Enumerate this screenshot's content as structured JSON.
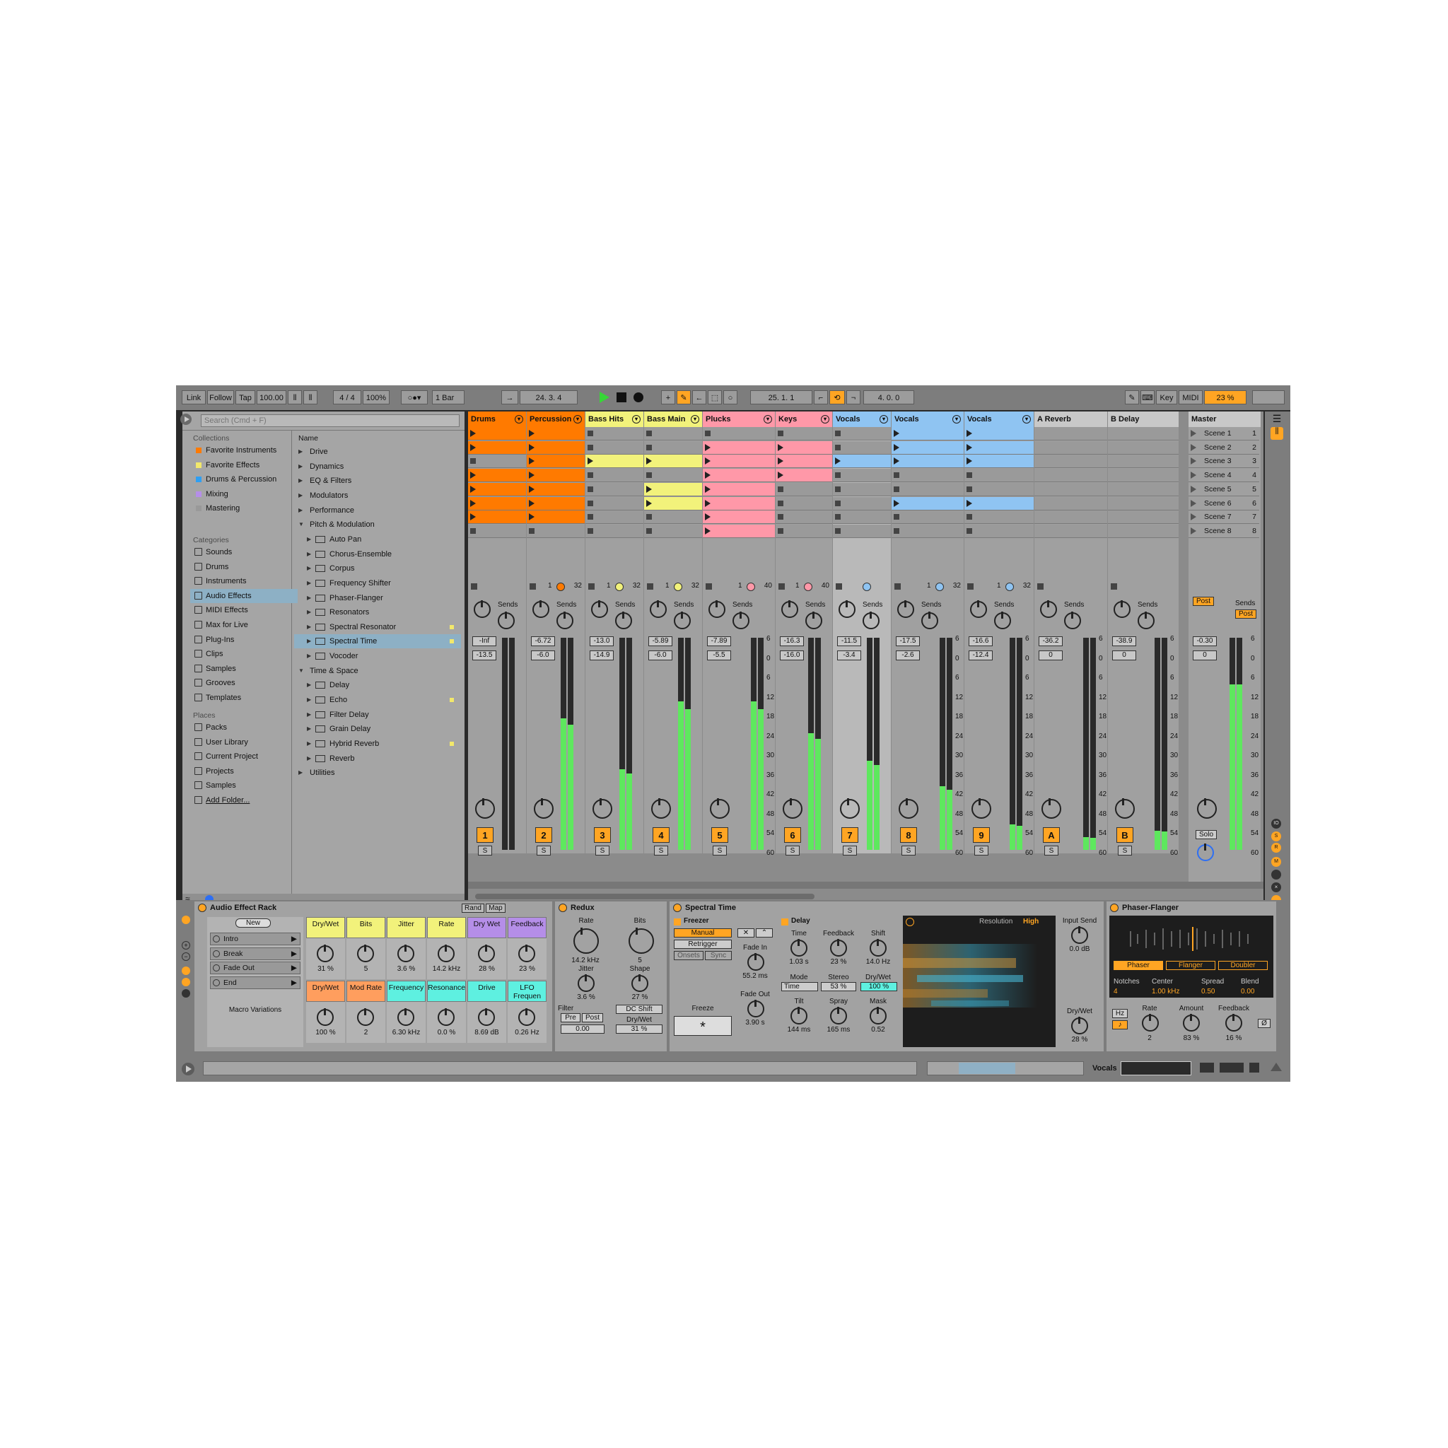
{
  "control_bar": {
    "link": "Link",
    "follow": "Follow",
    "tap": "Tap",
    "tempo": "100.00",
    "signature": "4 / 4",
    "zoom": "100%",
    "quantize": "1 Bar",
    "position": "24.  3.  4",
    "loop_start": "25.  1.  1",
    "loop_length": "4.  0.  0",
    "key": "Key",
    "midi": "MIDI",
    "cpu": "23 %"
  },
  "browser": {
    "search_placeholder": "Search (Cmd + F)",
    "collections_header": "Collections",
    "collections": [
      {
        "label": "Favorite Instruments",
        "color": "#ff7a00"
      },
      {
        "label": "Favorite Effects",
        "color": "#f2e86b"
      },
      {
        "label": "Drums & Percussion",
        "color": "#2e9ff3"
      },
      {
        "label": "Mixing",
        "color": "#b58ee8"
      },
      {
        "label": "Mastering",
        "color": "#999999"
      }
    ],
    "categories_header": "Categories",
    "categories": [
      "Sounds",
      "Drums",
      "Instruments",
      "Audio Effects",
      "MIDI Effects",
      "Max for Live",
      "Plug-Ins",
      "Clips",
      "Samples",
      "Grooves",
      "Templates"
    ],
    "places_header": "Places",
    "places": [
      "Packs",
      "User Library",
      "Current Project",
      "Projects",
      "Samples",
      "Add Folder..."
    ],
    "name_header": "Name",
    "files": [
      {
        "label": "Drive",
        "level": 0
      },
      {
        "label": "Dynamics",
        "level": 0
      },
      {
        "label": "EQ & Filters",
        "level": 0
      },
      {
        "label": "Modulators",
        "level": 0
      },
      {
        "label": "Performance",
        "level": 0
      },
      {
        "label": "Pitch & Modulation",
        "level": 0,
        "open": true
      },
      {
        "label": "Auto Pan",
        "level": 1
      },
      {
        "label": "Chorus-Ensemble",
        "level": 1
      },
      {
        "label": "Corpus",
        "level": 1
      },
      {
        "label": "Frequency Shifter",
        "level": 1
      },
      {
        "label": "Phaser-Flanger",
        "level": 1
      },
      {
        "label": "Resonators",
        "level": 1
      },
      {
        "label": "Spectral Resonator",
        "level": 1,
        "dot": true
      },
      {
        "label": "Spectral Time",
        "level": 1,
        "dot": true,
        "selected": true
      },
      {
        "label": "Vocoder",
        "level": 1
      },
      {
        "label": "Time & Space",
        "level": 0,
        "open": true
      },
      {
        "label": "Delay",
        "level": 1
      },
      {
        "label": "Echo",
        "level": 1,
        "dot": true
      },
      {
        "label": "Filter Delay",
        "level": 1
      },
      {
        "label": "Grain Delay",
        "level": 1
      },
      {
        "label": "Hybrid Reverb",
        "level": 1,
        "dot": true
      },
      {
        "label": "Reverb",
        "level": 1
      },
      {
        "label": "Utilities",
        "level": 0
      }
    ]
  },
  "tracks": [
    {
      "name": "Drums",
      "num": "1",
      "color": "#ff7a00",
      "clips": [
        1,
        1,
        0,
        1,
        1,
        1,
        1,
        0
      ],
      "vol": "-Inf",
      "pan": "-13.5",
      "level": 0.0,
      "clip_count": "",
      "dev": "",
      "sel": false
    },
    {
      "name": "Percussion",
      "num": "2",
      "color": "#ff7a00",
      "clips": [
        1,
        1,
        1,
        1,
        1,
        1,
        1,
        0
      ],
      "vol": "-6.72",
      "pan": "-6.0",
      "level": 0.62,
      "clip_count": "1",
      "dev": "32",
      "sel": false
    },
    {
      "name": "Bass Hits",
      "num": "3",
      "color": "#f2f27b",
      "clips": [
        0,
        0,
        1,
        0,
        0,
        0,
        0,
        0
      ],
      "vol": "-13.0",
      "pan": "-14.9",
      "level": 0.38,
      "clip_count": "1",
      "dev": "32",
      "sel": false
    },
    {
      "name": "Bass Main",
      "num": "4",
      "color": "#f2f27b",
      "clips": [
        0,
        0,
        1,
        0,
        1,
        1,
        0,
        0
      ],
      "vol": "-5.89",
      "pan": "-6.0",
      "level": 0.7,
      "clip_count": "1",
      "dev": "32",
      "sel": false
    },
    {
      "name": "Plucks",
      "num": "5",
      "color": "#ff98a8",
      "clips": [
        0,
        1,
        1,
        1,
        1,
        1,
        1,
        1
      ],
      "vol": "-7.89",
      "pan": "-5.5",
      "level": 0.7,
      "clip_count": "1",
      "dev": "40",
      "sel": false
    },
    {
      "name": "Keys",
      "num": "6",
      "color": "#ff98a8",
      "clips": [
        0,
        1,
        1,
        1,
        0,
        0,
        0,
        0
      ],
      "vol": "-16.3",
      "pan": "-16.0",
      "level": 0.55,
      "clip_count": "1",
      "dev": "40",
      "sel": false
    },
    {
      "name": "Vocals",
      "num": "7",
      "color": "#8fc4f2",
      "clips": [
        0,
        0,
        1,
        0,
        0,
        0,
        0,
        0
      ],
      "vol": "-11.5",
      "pan": "-3.4",
      "level": 0.42,
      "clip_count": "",
      "dev": "",
      "sel": true
    },
    {
      "name": "Vocals",
      "num": "8",
      "color": "#8fc4f2",
      "clips": [
        1,
        1,
        1,
        0,
        0,
        1,
        0,
        0
      ],
      "vol": "-17.5",
      "pan": "-2.6",
      "level": 0.3,
      "clip_count": "1",
      "dev": "32",
      "sel": false
    },
    {
      "name": "Vocals",
      "num": "9",
      "color": "#8fc4f2",
      "clips": [
        1,
        1,
        1,
        0,
        0,
        1,
        0,
        0
      ],
      "vol": "-16.6",
      "pan": "-12.4",
      "level": 0.12,
      "clip_count": "1",
      "dev": "32",
      "sel": false
    },
    {
      "name": "A Reverb",
      "num": "A",
      "color": "#c8c8c8",
      "clips": [
        0,
        0,
        0,
        0,
        0,
        0,
        0,
        0
      ],
      "vol": "-36.2",
      "pan": "0",
      "level": 0.06,
      "clip_count": "",
      "dev": "",
      "sel": false
    },
    {
      "name": "B Delay",
      "num": "B",
      "color": "#c8c8c8",
      "clips": [
        0,
        0,
        0,
        0,
        0,
        0,
        0,
        0
      ],
      "vol": "-38.9",
      "pan": "0",
      "level": 0.09,
      "clip_count": "",
      "dev": "",
      "sel": false
    }
  ],
  "master": {
    "name": "Master",
    "vol": "-0.30",
    "pan": "0",
    "level": 0.78,
    "solo": "Solo",
    "post": "Post"
  },
  "scenes": [
    "Scene 1",
    "Scene 2",
    "Scene 3",
    "Scene 4",
    "Scene 5",
    "Scene 6",
    "Scene 7",
    "Scene 8"
  ],
  "scene_nums": [
    "1",
    "2",
    "3",
    "4",
    "5",
    "6",
    "7",
    "8"
  ],
  "sends_label": "Sends",
  "db_scale": [
    "6",
    "0",
    "6",
    "12",
    "18",
    "24",
    "30",
    "36",
    "42",
    "48",
    "54",
    "60"
  ],
  "rack": {
    "title": "Audio Effect Rack",
    "rand": "Rand",
    "map": "Map",
    "new": "New",
    "variations": [
      "Intro",
      "Break",
      "Fade Out",
      "End"
    ],
    "variations_label": "Macro Variations",
    "macros": [
      {
        "name": "Dry/Wet",
        "value": "31 %",
        "color": "#f2f27b"
      },
      {
        "name": "Bits",
        "value": "5",
        "color": "#f2f27b"
      },
      {
        "name": "Jitter",
        "value": "3.6 %",
        "color": "#f2f27b"
      },
      {
        "name": "Rate",
        "value": "14.2 kHz",
        "color": "#f2f27b"
      },
      {
        "name": "Dry Wet",
        "value": "28 %",
        "color": "#b58ee8"
      },
      {
        "name": "Feedback",
        "value": "23 %",
        "color": "#b58ee8"
      },
      {
        "name": "Dry/Wet",
        "value": "100 %",
        "color": "#ff9e5e"
      },
      {
        "name": "Mod Rate",
        "value": "2",
        "color": "#ff9e5e"
      },
      {
        "name": "Frequency",
        "value": "6.30 kHz",
        "color": "#5ef0e0"
      },
      {
        "name": "Resonance",
        "value": "0.0 %",
        "color": "#5ef0e0"
      },
      {
        "name": "Drive",
        "value": "8.69 dB",
        "color": "#5ef0e0"
      },
      {
        "name": "LFO Frequen",
        "value": "0.26 Hz",
        "color": "#5ef0e0"
      }
    ]
  },
  "redux": {
    "title": "Redux",
    "rate": "Rate",
    "rate_value": "14.2 kHz",
    "jitter": "Jitter",
    "jitter_value": "3.6 %",
    "bits": "Bits",
    "bits_value": "5",
    "shape": "Shape",
    "shape_value": "27 %",
    "filter": "Filter",
    "pre": "Pre",
    "post": "Post",
    "filter_value": "0.00",
    "dc_shift": "DC Shift",
    "dry_wet": "Dry/Wet",
    "dry_wet_value": "31 %"
  },
  "spectral_time": {
    "title": "Spectral Time",
    "freezer": "Freezer",
    "manual": "Manual",
    "retrigger": "Retrigger",
    "onsets": "Onsets",
    "sync": "Sync",
    "fade_in": "Fade In",
    "fade_in_value": "55.2 ms",
    "fade_out": "Fade Out",
    "fade_out_value": "3.90 s",
    "freeze": "Freeze",
    "freeze_symbol": "*",
    "delay": "Delay",
    "time": "Time",
    "time_value": "1.03 s",
    "feedback": "Feedback",
    "feedback_value": "23 %",
    "shift": "Shift",
    "shift_value": "14.0 Hz",
    "mode": "Mode",
    "mode_value": "Time",
    "stereo": "Stereo",
    "stereo_value": "53 %",
    "dry_wet": "Dry/Wet",
    "dry_wet_value": "100 %",
    "tilt": "Tilt",
    "tilt_value": "144 ms",
    "spray": "Spray",
    "spray_value": "165 ms",
    "mask": "Mask",
    "mask_value": "0.52",
    "resolution": "Resolution",
    "resolution_value": "High",
    "input_send": "Input Send",
    "input_send_value": "0.0 dB",
    "dw2": "Dry/Wet",
    "dw2_value": "28 %"
  },
  "phaser": {
    "title": "Phaser-Flanger",
    "modes": [
      "Phaser",
      "Flanger",
      "Doubler"
    ],
    "notches": "Notches",
    "notches_value": "4",
    "center": "Center",
    "center_value": "1.00 kHz",
    "spread": "Spread",
    "spread_value": "0.50",
    "blend": "Blend",
    "blend_value": "0.00",
    "hz": "Hz",
    "rate": "Rate",
    "rate_value": "2",
    "amount": "Amount",
    "amount_value": "83 %",
    "feedback": "Feedback",
    "feedback_value": "16 %",
    "phase": "Ø"
  },
  "status": {
    "track": "Vocals"
  }
}
